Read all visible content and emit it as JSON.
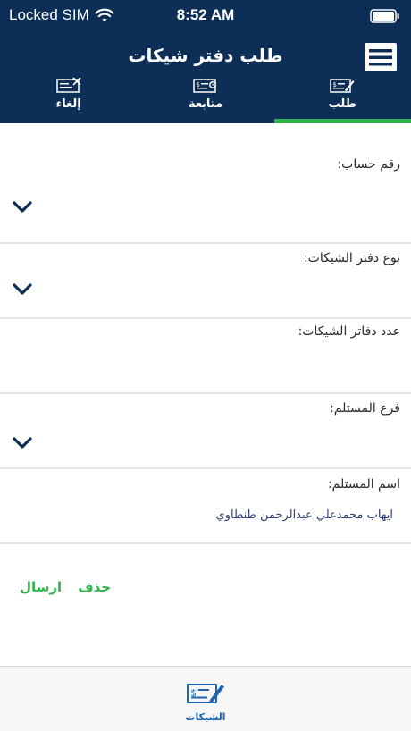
{
  "status": {
    "carrier": "Locked SIM",
    "time": "8:52 AM"
  },
  "header": {
    "title": "طلب دفتر شيكات"
  },
  "tabs": [
    {
      "label": "طلب",
      "icon": "cheque-write-icon",
      "active": true
    },
    {
      "label": "متابعة",
      "icon": "cheque-track-icon",
      "active": false
    },
    {
      "label": "إلغاء",
      "icon": "cheque-cancel-icon",
      "active": false
    }
  ],
  "form": {
    "account_number_label": "رقم حساب:",
    "chequebook_type_label": "نوع دفتر الشيكات:",
    "chequebook_count_label": "عدد دفاتر الشيكات:",
    "recipient_branch_label": "فرع المستلم:",
    "recipient_name_label": "اسم المستلم:",
    "recipient_name_value": "ايهاب محمدعلي عبدالرحمن طنطاوي"
  },
  "actions": {
    "delete": "حذف",
    "send": "ارسال"
  },
  "bottom_bar": {
    "label": "الشيكات",
    "icon": "cheque-write-icon"
  },
  "colors": {
    "header": "#0c2e57",
    "accent": "#2fb44b",
    "bottom_label": "#1d63b0"
  }
}
